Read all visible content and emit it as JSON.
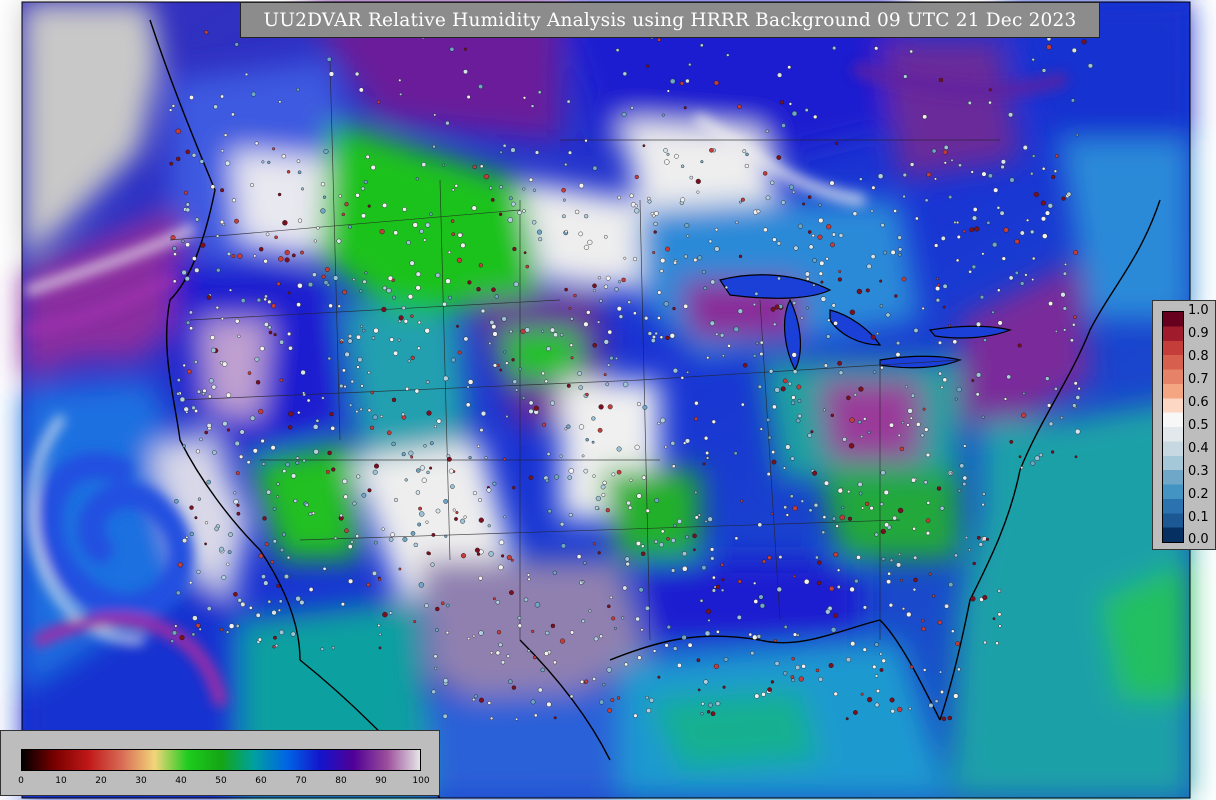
{
  "title": "UU2DVAR Relative Humidity Analysis using HRRR Background 09 UTC 21 Dec 2023",
  "right_colorbar": {
    "ticks": [
      "1.0",
      "0.9",
      "0.8",
      "0.7",
      "0.6",
      "0.5",
      "0.4",
      "0.3",
      "0.2",
      "0.1",
      "0.0"
    ],
    "colors_top_to_bottom": [
      "#67001f",
      "#a01b2c",
      "#c43d3a",
      "#d6604d",
      "#e58267",
      "#f4a582",
      "#fbd7c4",
      "#f7f7f7",
      "#e3e8ec",
      "#c8d8e2",
      "#a5c8d9",
      "#6ea7c8",
      "#4393c3",
      "#2a73b0",
      "#1b5894",
      "#053061"
    ]
  },
  "bottom_colorbar": {
    "ticks": [
      "0",
      "10",
      "20",
      "30",
      "40",
      "50",
      "60",
      "70",
      "80",
      "90",
      "100"
    ],
    "colors": [
      "#000000",
      "#7a0000",
      "#c01818",
      "#d86a55",
      "#f2d57a",
      "#1ecc1e",
      "#14a614",
      "#00a0a0",
      "#0064e6",
      "#1414cc",
      "#500096",
      "#9b4d9b",
      "#e6e6e6"
    ]
  },
  "map_colors": {
    "ocean_gray": "#c8c8c8",
    "moist_purple": "#7a1e8c",
    "moist_blue": "#1a1acc",
    "mid_blue": "#1f6fe6",
    "teal": "#17a5a0",
    "green": "#1cc21c",
    "dry_white": "#f0f0f0"
  }
}
